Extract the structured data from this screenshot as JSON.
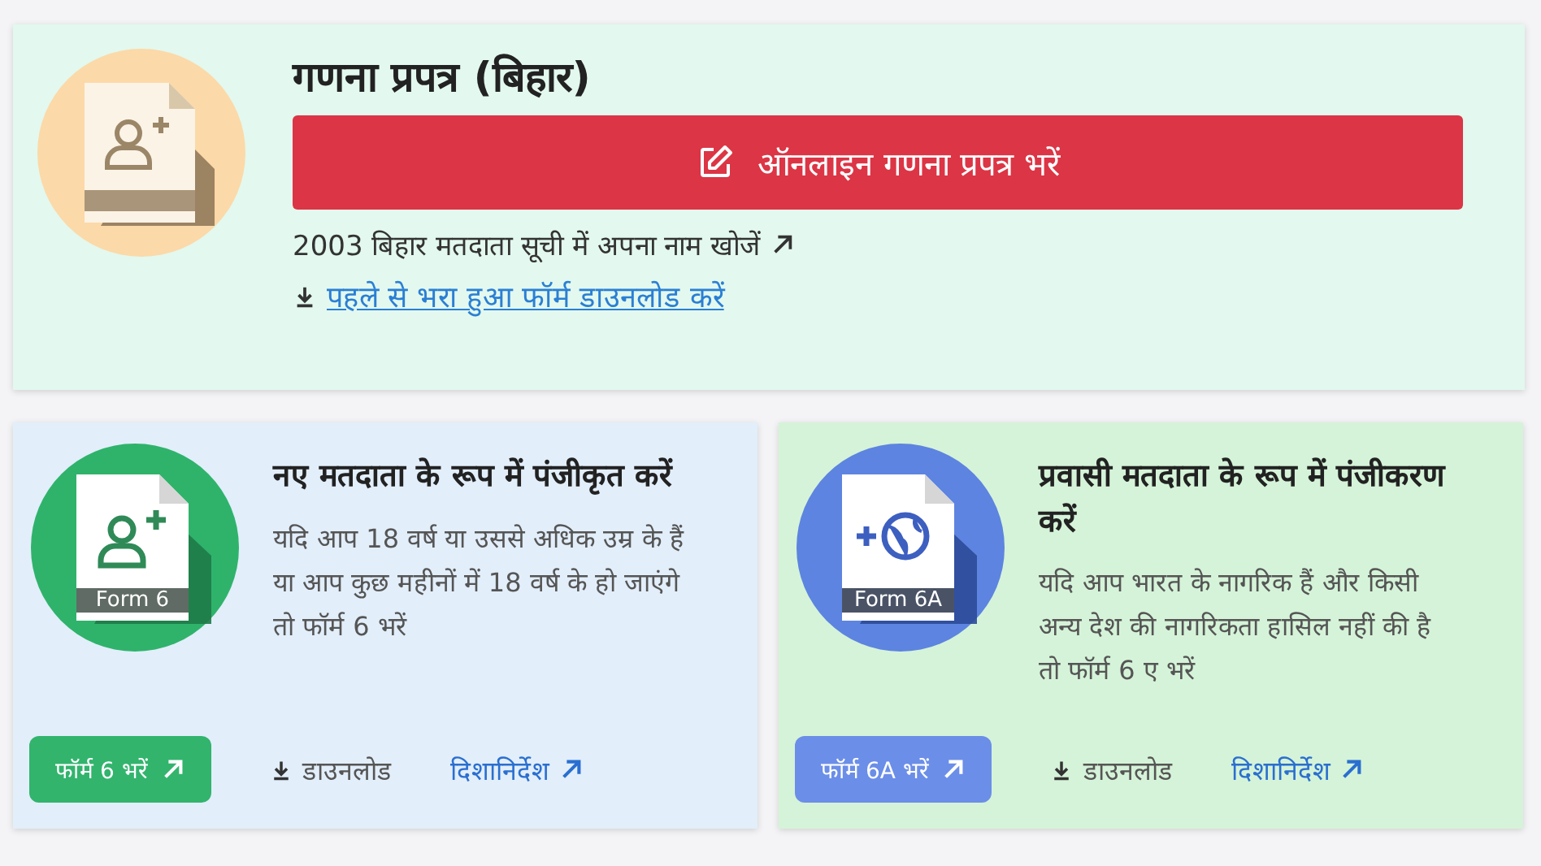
{
  "main_card": {
    "title": "गणना प्रपत्र (बिहार)",
    "primary_button": "ऑनलाइन गणना प्रपत्र भरें",
    "search_link": "2003 बिहार मतदाता सूची में अपना नाम खोजें",
    "download_link": "पहले से भरा हुआ फॉर्म डाउनलोड करें"
  },
  "form_cards": [
    {
      "kind": "person",
      "form_label": "Form 6",
      "title": "नए मतदाता के रूप में पंजीकृत करें",
      "description": "यदि आप 18 वर्ष या उससे अधिक उम्र के हैं या आप कुछ महीनों में 18 वर्ष के हो जाएंगे तो फॉर्म 6 भरें",
      "fill_button": "फॉर्म 6 भरें",
      "download": "डाउनलोड",
      "guidelines": "दिशानिर्देश"
    },
    {
      "kind": "globe",
      "form_label": "Form 6A",
      "title": "प्रवासी मतदाता के रूप में पंजीकरण करें",
      "description": "यदि आप भारत के नागरिक हैं और किसी अन्य देश की नागरिकता हासिल नहीं की है तो फॉर्म 6 ए भरें",
      "fill_button": "फॉर्म 6A भरें",
      "download": "डाउनलोड",
      "guidelines": "दिशानिर्देश"
    }
  ]
}
